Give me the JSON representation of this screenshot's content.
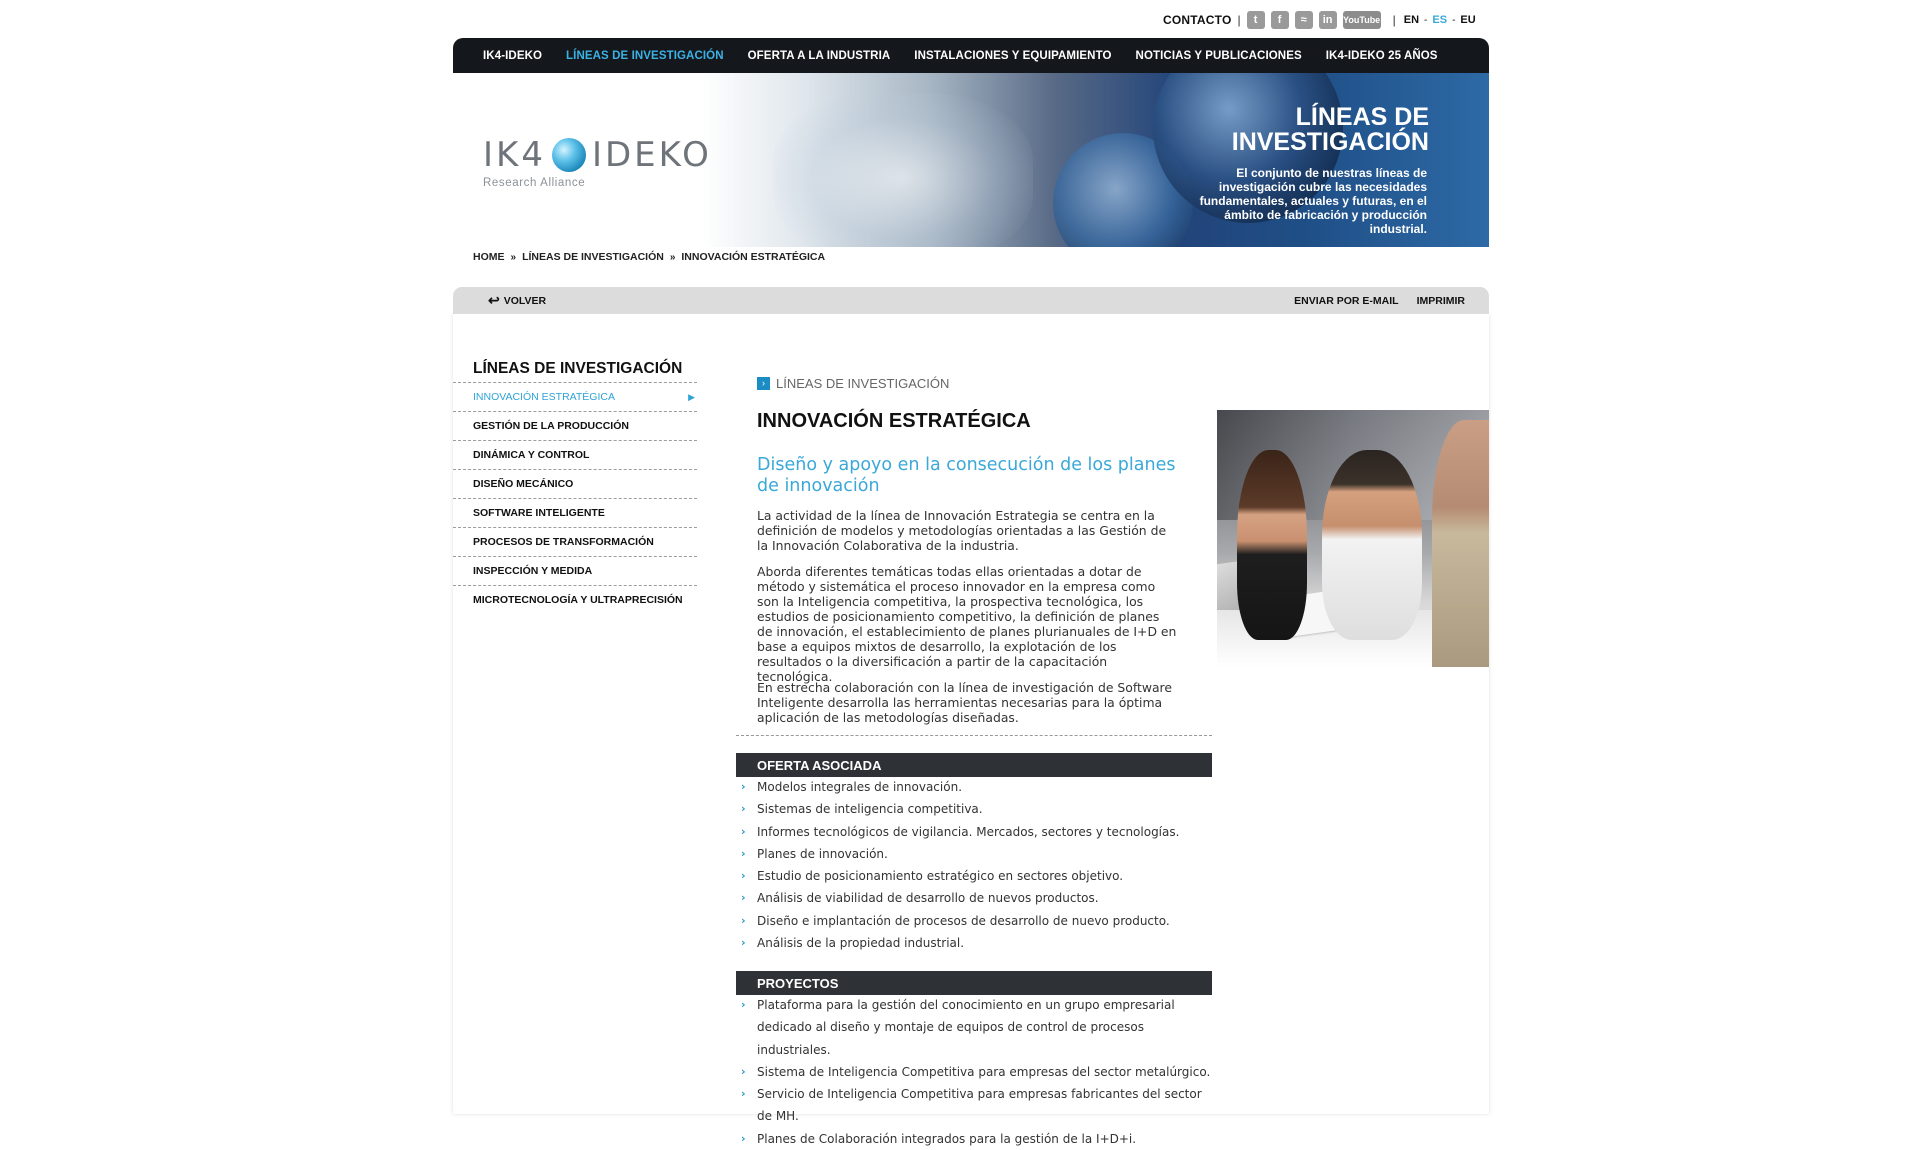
{
  "util": {
    "contacto": "CONTACTO",
    "social": [
      {
        "icon": "twitter-icon",
        "glyph": "t"
      },
      {
        "icon": "facebook-icon",
        "glyph": "f"
      },
      {
        "icon": "rss-icon",
        "glyph": "≈"
      },
      {
        "icon": "linkedin-icon",
        "glyph": "in"
      }
    ],
    "youtube": "YouTube",
    "langs": [
      "EN",
      "ES",
      "EU"
    ],
    "active_lang": "ES"
  },
  "nav": {
    "items": [
      "IK4-IDEKO",
      "LÍNEAS DE INVESTIGACIÓN",
      "OFERTA A LA INDUSTRIA",
      "INSTALACIONES Y EQUIPAMIENTO",
      "NOTICIAS Y PUBLICACIONES",
      "IK4-IDEKO 25 AÑOS"
    ],
    "active_index": 1
  },
  "banner": {
    "logo_left": "IK4",
    "logo_right": "IDEKO",
    "logo_sub": "Research Alliance",
    "title_line1": "LÍNEAS DE",
    "title_line2": "INVESTIGACIÓN",
    "text": "El conjunto de nuestras líneas de investigación cubre las necesidades fundamentales, actuales y futuras, en el ámbito de fabricación y producción industrial."
  },
  "breadcrumb": [
    "HOME",
    "LÍNEAS DE INVESTIGACIÓN",
    "INNOVACIÓN ESTRATÉGICA"
  ],
  "toolbar": {
    "volver": "VOLVER",
    "email": "ENVIAR POR E-MAIL",
    "print": "IMPRIMIR"
  },
  "sidebar": {
    "title": "LÍNEAS DE INVESTIGACIÓN",
    "items": [
      "INNOVACIÓN ESTRATÉGICA",
      "GESTIÓN DE LA PRODUCCIÓN",
      "DINÁMICA Y CONTROL",
      "DISEÑO MECÁNICO",
      "SOFTWARE INTELIGENTE",
      "PROCESOS DE TRANSFORMACIÓN",
      "INSPECCIÓN Y MEDIDA",
      "MICROTECNOLOGÍA Y ULTRAPRECISIÓN"
    ],
    "active_index": 0
  },
  "main": {
    "section_label": "LÍNEAS DE INVESTIGACIÓN",
    "title": "INNOVACIÓN ESTRATÉGICA",
    "subtitle": "Diseño y apoyo en la consecución de los planes de innovación",
    "paragraphs": [
      "La actividad de la línea de Innovación Estrategia se centra en la definición de modelos y metodologías orientadas a las Gestión de la Innovación Colaborativa de la industria.",
      "Aborda diferentes temáticas todas ellas orientadas a dotar de método y sistemática el proceso innovador en la empresa como son la Inteligencia competitiva, la prospectiva tecnológica, los estudios de posicionamiento competitivo, la definición de planes de innovación, el establecimiento de planes plurianuales de I+D en base a equipos mixtos de desarrollo, la explotación de los resultados o la diversificación a partir de la capacitación tecnológica.",
      "En estrecha colaboración con la línea de investigación de Software Inteligente desarrolla las herramientas necesarias para la óptima aplicación de las metodologías diseñadas."
    ],
    "oferta_title": "OFERTA ASOCIADA",
    "oferta": [
      "Modelos integrales de innovación.",
      "Sistemas de inteligencia competitiva.",
      "Informes tecnológicos de vigilancia. Mercados, sectores y tecnologías.",
      "Planes de innovación.",
      "Estudio de posicionamiento estratégico en sectores objetivo.",
      "Análisis de viabilidad de desarrollo de nuevos productos.",
      "Diseño e implantación de procesos de desarrollo de nuevo producto.",
      "Análisis de la propiedad industrial."
    ],
    "proyectos_title": "PROYECTOS",
    "proyectos": [
      "Plataforma para la gestión del conocimiento en un grupo empresarial dedicado al diseño y montaje de equipos de control de procesos industriales.",
      "Sistema de Inteligencia Competitiva para empresas del sector metalúrgico.",
      "Servicio de Inteligencia Competitiva para empresas fabricantes del sector de MH.",
      "Planes de Colaboración integrados para la gestión de la I+D+i."
    ]
  },
  "colors": {
    "accent": "#3aa8d8",
    "nav_bg": "#14181c",
    "section_bar": "#2e3236"
  }
}
